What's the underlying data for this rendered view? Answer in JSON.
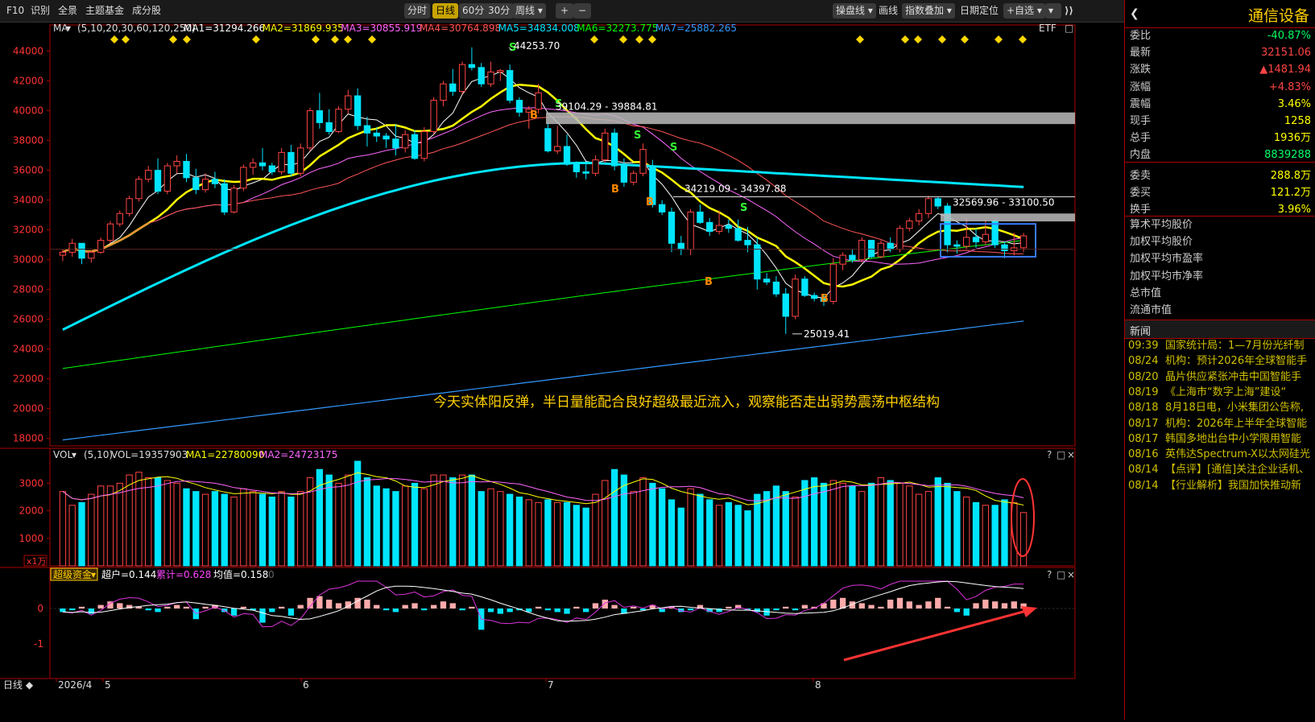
{
  "toolbar": {
    "left": [
      "F10",
      "识别",
      "全景",
      "主题基金",
      "成分股"
    ],
    "periods": [
      "分时",
      "日线",
      "60分",
      "30分",
      "周线"
    ],
    "active_period": "日线",
    "plus": "+",
    "minus": "−",
    "right": [
      "操盘线",
      "画线",
      "指数叠加",
      "日期定位",
      "+自选"
    ]
  },
  "ma_legend": {
    "label": "MA",
    "params": "(5,10,20,30,60,120,250)",
    "items": [
      {
        "text": "MA1=31294.266",
        "color": "#ffffff"
      },
      {
        "text": "MA2=31869.935",
        "color": "#ffff00"
      },
      {
        "text": "MA3=30855.919",
        "color": "#ff66ff"
      },
      {
        "text": "MA4=30764.898",
        "color": "#ff5555"
      },
      {
        "text": "MA5=34834.008",
        "color": "#00e5ff"
      },
      {
        "text": "MA6=32273.775",
        "color": "#00ff00"
      },
      {
        "text": "MA7=25882.265",
        "color": "#3399ff"
      }
    ],
    "etf": "ETF"
  },
  "y_axis": [
    "44000",
    "42000",
    "40000",
    "38000",
    "36000",
    "34000",
    "32000",
    "30000",
    "28000",
    "26000",
    "24000",
    "22000",
    "20000",
    "18000"
  ],
  "annotations": {
    "high": "44253.70",
    "low": "25019.41",
    "zone1": "39104.29 - 39884.81",
    "zone2": "34219.09 - 34397.88",
    "zone3": "32569.96 - 33100.50",
    "comment": "今天实体阳反弹，半日量能配合良好超级最近流入，观察能否走出弱势震荡中枢结构"
  },
  "vol_legend": {
    "label": "VOL",
    "params": "(5,10)",
    "vol": "VOL=19357903",
    "ma1": "MA1=22780090",
    "ma2": "MA2=24723175",
    "y_axis": [
      "3000",
      "2000",
      "1000"
    ],
    "unit": "x1万"
  },
  "fund_legend": {
    "label": "超级资金",
    "a": "超户=0.144",
    "b": "累计=0.628",
    "c": "均值=0.158",
    "d": "0",
    "y_axis": [
      "0",
      "-1"
    ]
  },
  "x_axis": [
    "2026/4",
    "5",
    "6",
    "7",
    "8"
  ],
  "bottom_label": "日线",
  "panel_icons": {
    "q": "?",
    "box": "□",
    "x": "×"
  },
  "right_panel": {
    "title": "通信设备",
    "rows": [
      {
        "k": "委比",
        "v": "-40.87%",
        "c": "#00ff66"
      },
      {
        "k": "最新",
        "v": "32151.06",
        "c": "#ff4444"
      },
      {
        "k": "涨跌",
        "v": "▲1481.94",
        "c": "#ff4444"
      },
      {
        "k": "涨幅",
        "v": "+4.83%",
        "c": "#ff4444"
      },
      {
        "k": "震幅",
        "v": "3.46%",
        "c": "#ffff00"
      },
      {
        "k": "现手",
        "v": "1258",
        "c": "#ffff00"
      },
      {
        "k": "总手",
        "v": "1936万",
        "c": "#ffff00"
      },
      {
        "k": "内盘",
        "v": "8839288",
        "c": "#00ff66"
      },
      {
        "k": "委卖",
        "v": "288.8万",
        "c": "#ffff00"
      },
      {
        "k": "委买",
        "v": "121.2万",
        "c": "#ffff00"
      },
      {
        "k": "换手",
        "v": "3.96%",
        "c": "#ffff00"
      }
    ],
    "stats": [
      "算术平均股价",
      "加权平均股价",
      "加权平均市盈率",
      "加权平均市净率",
      "总市值",
      "流通市值"
    ],
    "news_title": "新闻",
    "news": [
      {
        "t": "09:39",
        "h": "国家统计局：1—7月份光纤制"
      },
      {
        "t": "08/24",
        "h": "机构：预计2026年全球智能手"
      },
      {
        "t": "08/20",
        "h": "晶片供应紧张冲击中国智能手"
      },
      {
        "t": "08/19",
        "h": "《上海市“数字上海”建设“"
      },
      {
        "t": "08/18",
        "h": "8月18日电，小米集团公告称,"
      },
      {
        "t": "08/17",
        "h": "机构：2026年上半年全球智能"
      },
      {
        "t": "08/17",
        "h": "韩国多地出台中小学限用智能"
      },
      {
        "t": "08/16",
        "h": "英伟达Spectrum-X以太网硅光"
      },
      {
        "t": "08/14",
        "h": "【点评】[通信]关注企业话机、"
      },
      {
        "t": "08/14",
        "h": "【行业解析】我国加快推动新"
      }
    ]
  },
  "colors": {
    "up": "#ff4444",
    "down": "#00e5ff",
    "ma5": "#ffffff",
    "ma10": "#ffff00",
    "ma20": "#ff66ff",
    "ma30": "#ff5555",
    "ma60": "#00e5ff",
    "ma120": "#00ff00",
    "ma250": "#3399ff",
    "fund_up": "#ffaaaa",
    "fund_down": "#00e5ff"
  },
  "chart_data": {
    "type": "candlestick",
    "ylim": [
      17500,
      45000
    ],
    "candles": [
      [
        30300,
        30700,
        29900,
        30500
      ],
      [
        30500,
        31400,
        30200,
        31100
      ],
      [
        31100,
        31000,
        29700,
        30100
      ],
      [
        30100,
        30600,
        29800,
        30500
      ],
      [
        30500,
        31500,
        30400,
        31300
      ],
      [
        31300,
        32600,
        31100,
        32400
      ],
      [
        32400,
        33300,
        32200,
        33100
      ],
      [
        33100,
        34300,
        32900,
        34100
      ],
      [
        34100,
        35600,
        33900,
        35400
      ],
      [
        35400,
        36300,
        35200,
        36000
      ],
      [
        36000,
        36800,
        34400,
        34600
      ],
      [
        34600,
        36500,
        34400,
        36300
      ],
      [
        36300,
        37000,
        35800,
        36600
      ],
      [
        36600,
        37100,
        35200,
        35500
      ],
      [
        35500,
        36100,
        34400,
        34700
      ],
      [
        34700,
        35800,
        34500,
        35400
      ],
      [
        35400,
        35900,
        34800,
        35100
      ],
      [
        35100,
        35400,
        33000,
        33200
      ],
      [
        33200,
        35000,
        33100,
        34800
      ],
      [
        34800,
        36400,
        34600,
        36200
      ],
      [
        36200,
        36800,
        35700,
        36500
      ],
      [
        36500,
        37500,
        36000,
        36300
      ],
      [
        36300,
        36500,
        35700,
        35900
      ],
      [
        35900,
        37500,
        35700,
        37200
      ],
      [
        37200,
        37700,
        35600,
        35800
      ],
      [
        35800,
        37800,
        35600,
        37500
      ],
      [
        37500,
        40200,
        37300,
        40000
      ],
      [
        40000,
        41200,
        38800,
        39200
      ],
      [
        39200,
        40100,
        38400,
        38600
      ],
      [
        38600,
        40300,
        38500,
        40100
      ],
      [
        40100,
        41400,
        39800,
        41000
      ],
      [
        41000,
        41500,
        38700,
        39000
      ],
      [
        39000,
        39600,
        37600,
        38500
      ],
      [
        38500,
        38900,
        37900,
        38300
      ],
      [
        38300,
        38500,
        37500,
        38100
      ],
      [
        38100,
        39100,
        37000,
        37500
      ],
      [
        37500,
        38700,
        37200,
        38400
      ],
      [
        38400,
        38700,
        36700,
        36800
      ],
      [
        36800,
        38900,
        36600,
        38600
      ],
      [
        38600,
        40900,
        38400,
        40700
      ],
      [
        40700,
        42000,
        40300,
        41800
      ],
      [
        41800,
        42800,
        41000,
        41300
      ],
      [
        41300,
        43300,
        41100,
        43100
      ],
      [
        43100,
        44253,
        42700,
        42900
      ],
      [
        42900,
        43200,
        41600,
        41800
      ],
      [
        41800,
        43300,
        41600,
        42600
      ],
      [
        42600,
        42800,
        42000,
        42700
      ],
      [
        42700,
        43100,
        40500,
        40700
      ],
      [
        40700,
        40900,
        39600,
        39900
      ],
      [
        39900,
        40300,
        38800,
        40100
      ],
      [
        40100,
        41800,
        39800,
        41200
      ],
      [
        38800,
        39200,
        37200,
        37300
      ],
      [
        37300,
        39000,
        37100,
        37600
      ],
      [
        37600,
        38400,
        36300,
        36400
      ],
      [
        36400,
        36600,
        35500,
        35900
      ],
      [
        35900,
        36400,
        35400,
        35800
      ],
      [
        35800,
        37000,
        35600,
        36700
      ],
      [
        36700,
        38800,
        36500,
        38500
      ],
      [
        38500,
        38800,
        36000,
        36300
      ],
      [
        36300,
        36800,
        34900,
        35200
      ],
      [
        35200,
        36000,
        35000,
        35800
      ],
      [
        35800,
        37800,
        35600,
        37400
      ],
      [
        36300,
        36700,
        33500,
        33700
      ],
      [
        33700,
        34000,
        33000,
        33200
      ],
      [
        33200,
        33500,
        30500,
        31100
      ],
      [
        31100,
        31600,
        30300,
        30700
      ],
      [
        30700,
        33400,
        30300,
        33200
      ],
      [
        33200,
        33700,
        32400,
        32500
      ],
      [
        32500,
        32800,
        31600,
        31900
      ],
      [
        31900,
        33300,
        31700,
        32300
      ],
      [
        32300,
        32700,
        31800,
        32100
      ],
      [
        32100,
        32700,
        31200,
        31300
      ],
      [
        31300,
        32200,
        30500,
        31000
      ],
      [
        31000,
        31500,
        28000,
        28700
      ],
      [
        28700,
        29100,
        28300,
        28500
      ],
      [
        28500,
        28900,
        27500,
        27700
      ],
      [
        27700,
        28100,
        25019,
        26200
      ],
      [
        26200,
        29000,
        26000,
        28700
      ],
      [
        28700,
        28900,
        27500,
        27600
      ],
      [
        27600,
        27800,
        27200,
        27400
      ],
      [
        27400,
        27700,
        26900,
        27200
      ],
      [
        27200,
        30100,
        27000,
        29700
      ],
      [
        29700,
        30500,
        29300,
        30300
      ],
      [
        30300,
        30700,
        29800,
        30000
      ],
      [
        30000,
        31500,
        29800,
        31300
      ],
      [
        31300,
        31000,
        30100,
        30200
      ],
      [
        30200,
        31300,
        30100,
        31100
      ],
      [
        31100,
        31500,
        30500,
        30700
      ],
      [
        30700,
        32300,
        30500,
        32100
      ],
      [
        32100,
        32800,
        31900,
        32600
      ],
      [
        32600,
        33400,
        32300,
        33100
      ],
      [
        33100,
        34300,
        32800,
        34100
      ],
      [
        34100,
        34200,
        33400,
        33600
      ],
      [
        33600,
        33800,
        30500,
        31000
      ],
      [
        31000,
        31300,
        30400,
        30900
      ],
      [
        30900,
        32800,
        30700,
        31500
      ],
      [
        31500,
        32100,
        30800,
        31200
      ],
      [
        31200,
        32700,
        31000,
        31700
      ],
      [
        32600,
        32700,
        30800,
        31000
      ],
      [
        31000,
        31200,
        30100,
        30600
      ],
      [
        30600,
        31800,
        30300,
        30800
      ],
      [
        30800,
        31800,
        30500,
        31600
      ]
    ],
    "volume": [
      2700,
      2200,
      2300,
      2600,
      2900,
      2900,
      3000,
      3300,
      3400,
      3200,
      3200,
      3100,
      3000,
      2800,
      2700,
      2600,
      2700,
      2600,
      2500,
      2800,
      2700,
      2600,
      2500,
      2700,
      2500,
      2700,
      3200,
      3500,
      3300,
      3000,
      3300,
      3800,
      3200,
      2900,
      2800,
      2700,
      2900,
      3000,
      2800,
      3300,
      3300,
      3200,
      3300,
      3300,
      2700,
      2800,
      2700,
      2600,
      2500,
      2400,
      2300,
      2400,
      2300,
      2300,
      2200,
      2100,
      2600,
      3100,
      3500,
      3300,
      2700,
      3200,
      3000,
      2800,
      2400,
      2100,
      2800,
      2600,
      2400,
      2200,
      2300,
      2200,
      2000,
      2600,
      2700,
      2900,
      2700,
      2500,
      3100,
      3200,
      3000,
      3100,
      3000,
      2900,
      2700,
      3000,
      3200,
      3100,
      3000,
      2900,
      2600,
      2700,
      3200,
      3000,
      2700,
      2500,
      2300,
      2200,
      2200,
      2400,
      2300,
      1936
    ],
    "fund": [
      -0.1,
      -0.05,
      0.05,
      -0.15,
      0.1,
      0.2,
      0.15,
      0.1,
      0.05,
      -0.05,
      -0.1,
      0.05,
      0.1,
      0.05,
      -0.3,
      0.05,
      0.1,
      -0.1,
      -0.2,
      0.05,
      -0.05,
      -0.4,
      -0.1,
      0.05,
      -0.2,
      0.1,
      0.3,
      0.35,
      0.25,
      0.15,
      0.2,
      0.3,
      0.25,
      0.1,
      -0.05,
      -0.1,
      0.1,
      0.15,
      -0.05,
      0.1,
      0.2,
      0.15,
      -0.05,
      0.05,
      -0.6,
      -0.1,
      -0.15,
      -0.1,
      -0.05,
      -0.1,
      0.05,
      -0.05,
      -0.1,
      -0.15,
      0.05,
      -0.1,
      0.15,
      0.25,
      0.1,
      -0.15,
      0.05,
      -0.05,
      0.1,
      -0.1,
      0.05,
      -0.1,
      -0.05,
      0.1,
      -0.1,
      -0.1,
      0.05,
      0.1,
      -0.05,
      -0.1,
      -0.2,
      -0.05,
      0.05,
      -0.05,
      0.1,
      0.05,
      0.15,
      0.25,
      0.3,
      0.2,
      0.15,
      0.1,
      0.05,
      0.25,
      0.3,
      0.2,
      0.1,
      0.2,
      0.3,
      0.05,
      -0.1,
      -0.2,
      0.15,
      0.25,
      0.2,
      0.15,
      0.2,
      0.144
    ]
  }
}
